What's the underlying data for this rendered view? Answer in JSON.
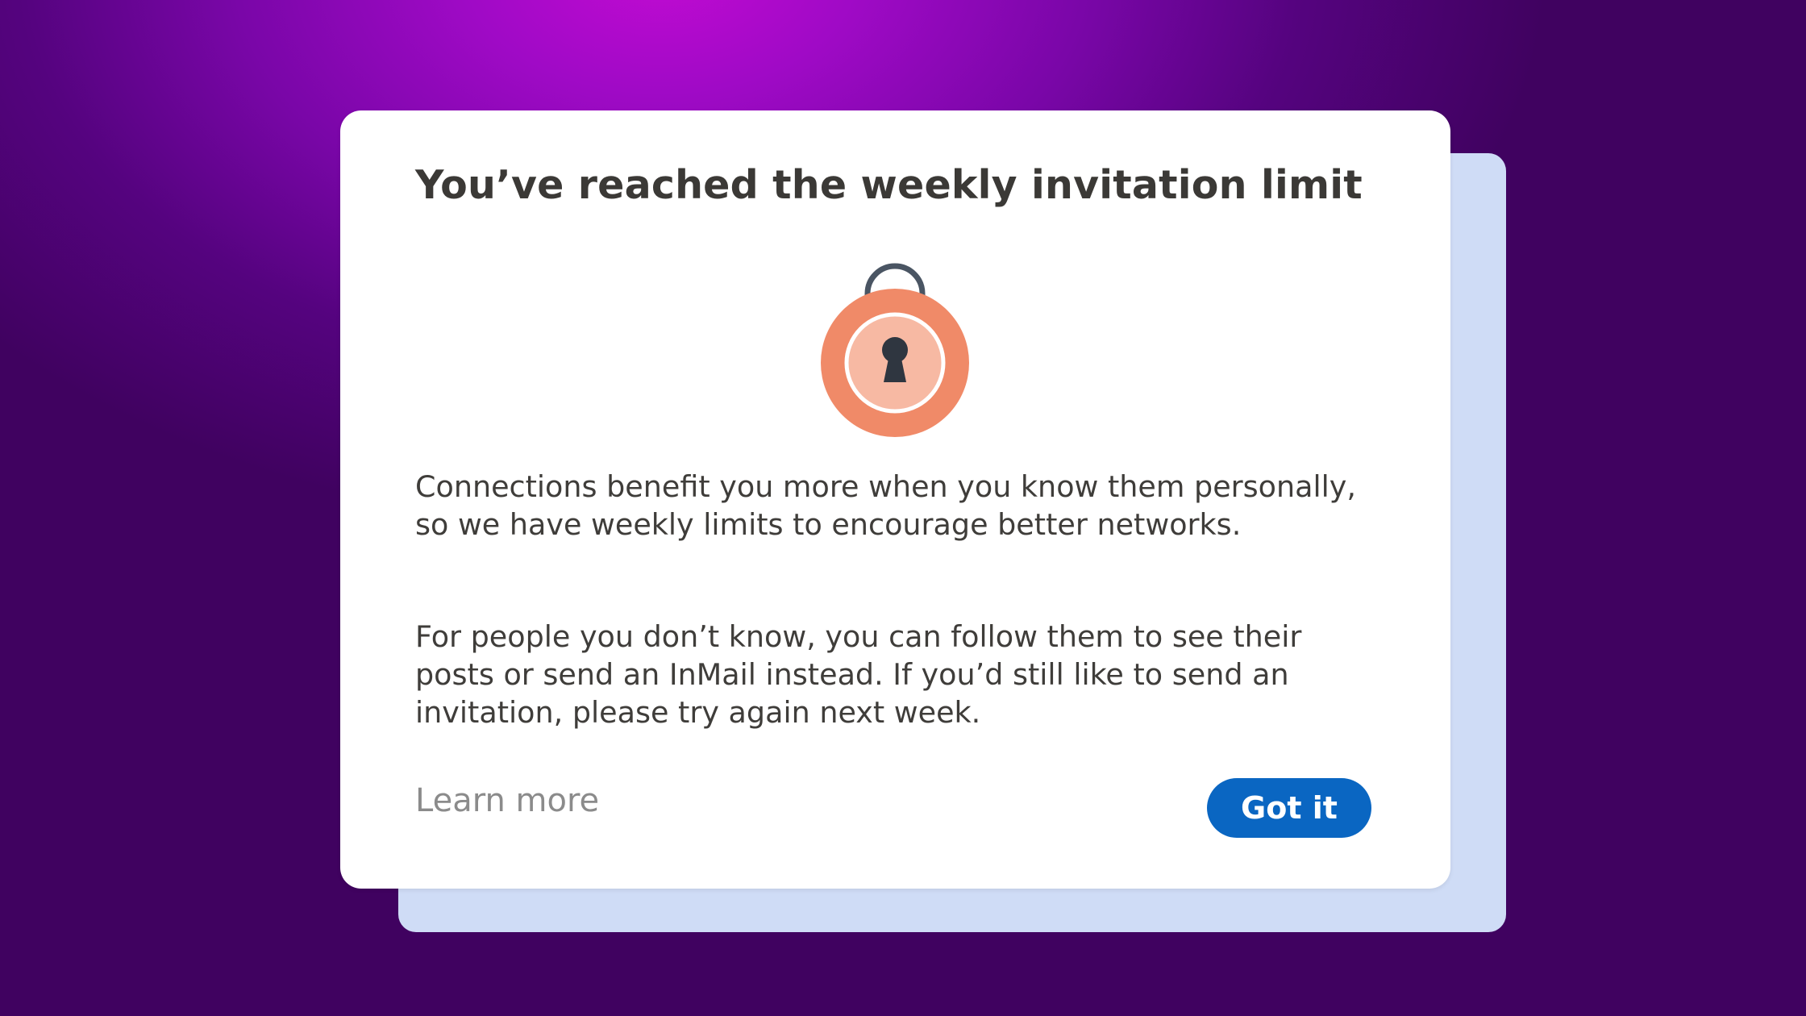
{
  "dialog": {
    "title": "You’ve reached the weekly invitation limit",
    "icon": "padlock-icon",
    "paragraphs": [
      "Connections benefit you more when you know them personally, so we have weekly limits to encourage better networks.",
      "For people you don’t know, you can follow them to see their posts or send an InMail instead. If you’d still like to send an invitation, please try again next week."
    ],
    "learn_more_label": "Learn more",
    "got_it_label": "Got it"
  },
  "colors": {
    "background": "#7a06a8",
    "backdrop_card": "#cfdcf6",
    "primary_button": "#0a66c2",
    "lock_body": "#f08a68",
    "lock_inner": "#f7b9a3",
    "lock_shackle": "#4a5563"
  }
}
